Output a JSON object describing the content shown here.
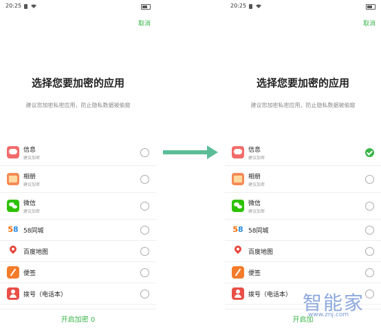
{
  "status_bar": {
    "time": "20:25"
  },
  "cancel_label": "取消",
  "title": "选择您要加密的应用",
  "subtitle": "建议您加密私密应用，防止隐私数据被偷窥",
  "apps": [
    {
      "name": "信息",
      "sub": "建议加密",
      "icon": "message-icon"
    },
    {
      "name": "相册",
      "sub": "建议加密",
      "icon": "gallery-icon"
    },
    {
      "name": "微信",
      "sub": "建议加密",
      "icon": "wechat-icon"
    },
    {
      "name": "58同城",
      "icon": "58-icon"
    },
    {
      "name": "百度地图",
      "icon": "map-icon"
    },
    {
      "name": "便签",
      "icon": "notes-icon"
    },
    {
      "name": "拨号（电话本）",
      "icon": "dialer-icon"
    }
  ],
  "left_panel": {
    "button_label": "开启加密 0",
    "checked": [
      false,
      false,
      false,
      false,
      false,
      false,
      false
    ]
  },
  "right_panel": {
    "button_label": "开启加",
    "checked": [
      true,
      false,
      false,
      false,
      false,
      false,
      false
    ]
  },
  "icon_58": {
    "a": "5",
    "b": "8"
  },
  "watermark": {
    "text": "智能家",
    "url": "www.znj.com"
  },
  "colors": {
    "accent": "#3bb54a",
    "arrow": "#5bbd98"
  }
}
